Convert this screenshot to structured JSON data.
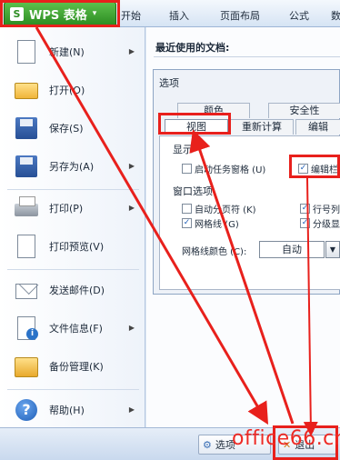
{
  "ribbon": {
    "app_button": "WPS 表格",
    "logo_letter": "S",
    "tabs": [
      "开始",
      "插入",
      "页面布局",
      "公式",
      "数"
    ]
  },
  "menu": {
    "items": [
      {
        "label": "新建(N)",
        "icon": "new-doc-icon",
        "has_arrow": true
      },
      {
        "label": "打开(O)",
        "icon": "open-folder-icon",
        "has_arrow": false
      },
      {
        "label": "保存(S)",
        "icon": "save-icon",
        "has_arrow": false
      },
      {
        "label": "另存为(A)",
        "icon": "save-as-icon",
        "has_arrow": true
      },
      {
        "label": "打印(P)",
        "icon": "print-icon",
        "has_arrow": true
      },
      {
        "label": "打印预览(V)",
        "icon": "print-preview-icon",
        "has_arrow": false
      },
      {
        "label": "发送邮件(D)",
        "icon": "mail-icon",
        "has_arrow": false
      },
      {
        "label": "文件信息(F)",
        "icon": "file-info-icon",
        "has_arrow": true
      },
      {
        "label": "备份管理(K)",
        "icon": "backup-icon",
        "has_arrow": false
      },
      {
        "label": "帮助(H)",
        "icon": "help-icon",
        "has_arrow": true
      }
    ]
  },
  "recent": {
    "title": "最近使用的文档:"
  },
  "dialog": {
    "title": "选项",
    "tabs_row1": [
      "颜色",
      "安全性"
    ],
    "tabs_row2": [
      "视图",
      "重新计算",
      "编辑"
    ],
    "section_display": "显示",
    "chk_start_pane": "启动任务窗格 (U)",
    "chk_edit_bar": "编辑栏",
    "section_window": "窗口选项",
    "chk_page_break": "自动分页符 (K)",
    "chk_gridlines": "网格线 (G)",
    "chk_row_col": "行号列",
    "chk_outline": "分级显",
    "gridline_color_label": "网格线颜色 (C):",
    "gridline_color_value": "自动",
    "check_mark": "✓"
  },
  "bottom": {
    "btn_options": "选项",
    "btn_exit": "退出"
  },
  "watermark": "office66.cn",
  "colors": {
    "annotation_red": "#e8201c",
    "wps_green": "#2e8e23"
  }
}
